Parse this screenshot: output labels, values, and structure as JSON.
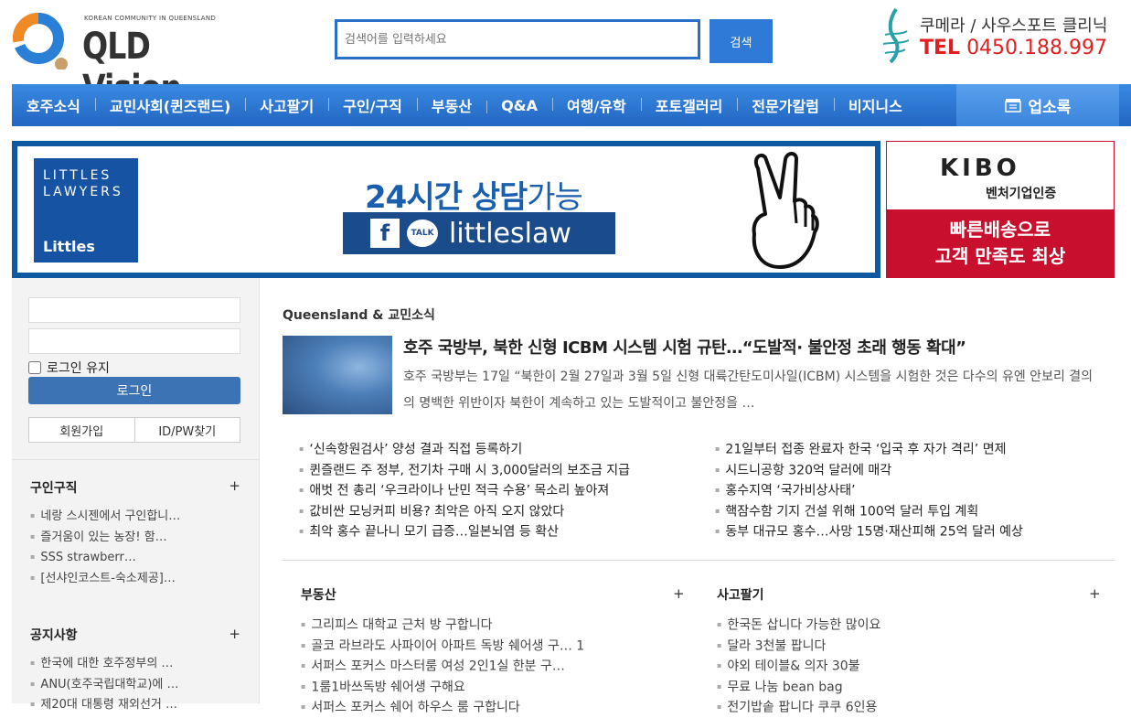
{
  "brand": {
    "small_text": "KOREAN COMMUNITY IN QUEENSLAND",
    "name": "QLD Vision",
    "colors": {
      "ring_blue": "#2a7fd6",
      "ring_orange": "#f08a24",
      "ring_red": "#d62a2a"
    }
  },
  "search": {
    "placeholder": "검색어를 입력하세요",
    "button": "검색"
  },
  "clinic_ad": {
    "name": "쿠메라 / 사우스포트 클리닉",
    "tel_label": "TEL",
    "tel_number": "0450.188.997"
  },
  "nav": {
    "items": [
      "호주소식",
      "교민사회(퀸즈랜드)",
      "사고팔기",
      "구인/구직",
      "부동산",
      "Q&A",
      "여행/유학",
      "포토갤러리",
      "전문가칼럼",
      "비지니스"
    ],
    "directory": "업소록",
    "color": "#2a74cf"
  },
  "banner_law": {
    "logo_line1": "LITTLES",
    "logo_line2": "LAWYERS",
    "logo_brand": "Littles",
    "headline_bold": "24시간 상담",
    "headline_light": "가능",
    "fb": "f",
    "talk": "TALK",
    "social_name": "littleslaw"
  },
  "banner_kibo": {
    "logo": "KIBO",
    "sub": "벤처기업인증",
    "line1": "빠른배송으로",
    "line2": "고객 만족도 최상"
  },
  "login": {
    "keep_label": "로그인 유지",
    "login_button": "로그인",
    "signup": "회원가입",
    "find": "ID/PW찾기"
  },
  "sidebar": {
    "jobs": {
      "title": "구인구직",
      "plus": "+",
      "items": [
        "네랑 스시젠에서 구인합니…",
        "즐거움이 있는 농장! 함…",
        "SSS strawberr…",
        "[선샤인코스트-숙소제공]…"
      ]
    },
    "notice": {
      "title": "공지사항",
      "plus": "+",
      "items": [
        "한국에 대한 호주정부의 …",
        "ANU(호주국립대학교)에 …",
        "제20대 대통령 재외선거 …"
      ]
    }
  },
  "main": {
    "category": "Queensland & 교민소식",
    "featured": {
      "title": "호주 국방부, 북한 신형 ICBM 시스템 시험 규탄…“도발적· 불안정 초래 행동 확대”",
      "desc": "호주 국방부는 17일 “북한이 2월 27일과 3월 5일 신형 대륙간탄도미사일(ICBM) 시스템을 시험한 것은 다수의 유엔 안보리 결의의 명백한 위반이자 북한이 계속하고 있는 도발적이고 불안정을 …"
    },
    "news_left": [
      "‘신속항원검사’ 양성 결과 직접 등록하기",
      "퀸즐랜드 주 정부, 전기차 구매 시 3,000달러의 보조금 지급",
      "애벗 전 총리 ‘우크라이나 난민 적극 수용’ 목소리 높아져",
      "값비싼 모닝커피 비용? 최악은 아직 오지 않았다",
      "최악 홍수 끝나니 모기 급증…일본뇌염 등 확산"
    ],
    "news_right": [
      "21일부터 접종 완료자 한국 ‘입국 후 자가 격리’ 면제",
      "시드니공항 320억 달러에 매각",
      "홍수지역 ‘국가비상사태’",
      "핵잠수함 기지 건설 위해 100억 달러 투입 계획",
      "동부 대규모 홍수…사망 15명·재산피해 25억 달러 예상"
    ],
    "realestate": {
      "title": "부동산",
      "plus": "+",
      "items": [
        "그리피스 대학교 근처 방 구합니다",
        "골코 라브라도 사파이어 아파트 독방 쉐어생 구… 1",
        "서퍼스 포커스 마스터룸 여성 2인1실 한분 구…",
        "1룸1바쓰독방 쉐어생 구해요",
        "서퍼스 포커스 쉐어 하우스 룸 구합니다"
      ]
    },
    "buysell": {
      "title": "사고팔기",
      "plus": "+",
      "items": [
        "한국돈 삽니다 가능한 많이요",
        "달라 3천불 팝니다",
        "야외 테이블& 의자 30불",
        "무료 나눔 bean bag",
        "전기밥솥 팝니다 쿠쿠 6인용"
      ]
    }
  }
}
